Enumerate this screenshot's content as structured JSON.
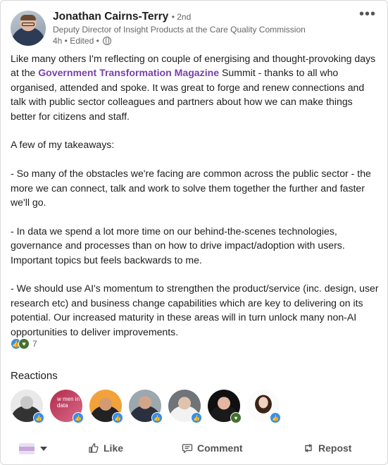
{
  "author": {
    "name": "Jonathan Cairns-Terry",
    "degree": "• 2nd",
    "headline": "Deputy Director of Insight Products at the Care Quality Commission",
    "meta": "4h • Edited •"
  },
  "post": {
    "p1_before": "Like many others I'm reflecting on couple of energising and thought-provoking days at the ",
    "p1_mention": "Government Transformation Magazine",
    "p1_after": " Summit - thanks to all who organised, attended and spoke. It was great to forge and renew connections and talk with public sector colleagues and partners about how we can make things better for citizens and staff.",
    "p2": "A few of my takeaways:",
    "p3": "- So many of the obstacles we're facing are common across the public sector - the more we can connect, talk and work to solve them together the further and faster we'll go.",
    "p4": "- In data we spend a lot more time on our behind-the-scenes technologies, governance and processes than on how to drive impact/adoption with users. Important topics but feels backwards to me.",
    "p5": "- We should use AI's momentum to strengthen the product/service (inc. design, user research etc) and business change capabilities which are key to delivering on its potential. Our increased maturity in these areas will in turn unlock many non-AI opportunities to deliver improvements."
  },
  "reactions": {
    "count": "7",
    "title": "Reactions",
    "icons": [
      "like-icon",
      "support-icon"
    ],
    "reactor_badges": [
      "like",
      "like",
      "like",
      "like",
      "like",
      "support",
      "like"
    ],
    "reactor2_text": "w men in data"
  },
  "actions": {
    "like": "Like",
    "comment": "Comment",
    "repost": "Repost"
  },
  "colors": {
    "mention": "#7a3fa8",
    "like_badge": "#378fe9",
    "support_badge": "#44712e"
  }
}
